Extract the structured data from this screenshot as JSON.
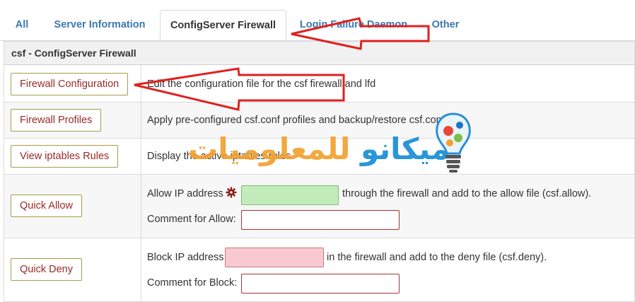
{
  "tabs": {
    "all": "All",
    "server_info": "Server Information",
    "csf": "ConfigServer Firewall",
    "lfd": "Login Failure Daemon",
    "other": "Other"
  },
  "panel": {
    "title": "csf - ConfigServer Firewall"
  },
  "rows": {
    "firewall_config": {
      "button": "Firewall Configuration",
      "desc": "Edit the configuration file for the csf firewall and lfd"
    },
    "profiles": {
      "button": "Firewall Profiles",
      "desc": "Apply pre-configured csf.conf profiles and backup/restore csf.conf"
    },
    "iptables": {
      "button": "View iptables Rules",
      "desc": "Display the active iptables rules"
    },
    "allow": {
      "button": "Quick Allow",
      "ip_label": "Allow IP address",
      "ip_suffix": "through the firewall and add to the allow file (csf.allow).",
      "comment_label": "Comment for Allow:"
    },
    "deny": {
      "button": "Quick Deny",
      "ip_label": "Block IP address",
      "ip_suffix": "in the firewall and add to the deny file (csf.deny).",
      "comment_label": "Comment for Block:"
    }
  },
  "watermark": {
    "part1": "ميكانو",
    "part2": "للمعلوميات"
  },
  "colors": {
    "link": "#3b79b0",
    "button_text": "#9a2a2a",
    "arrow": "#e02020"
  }
}
